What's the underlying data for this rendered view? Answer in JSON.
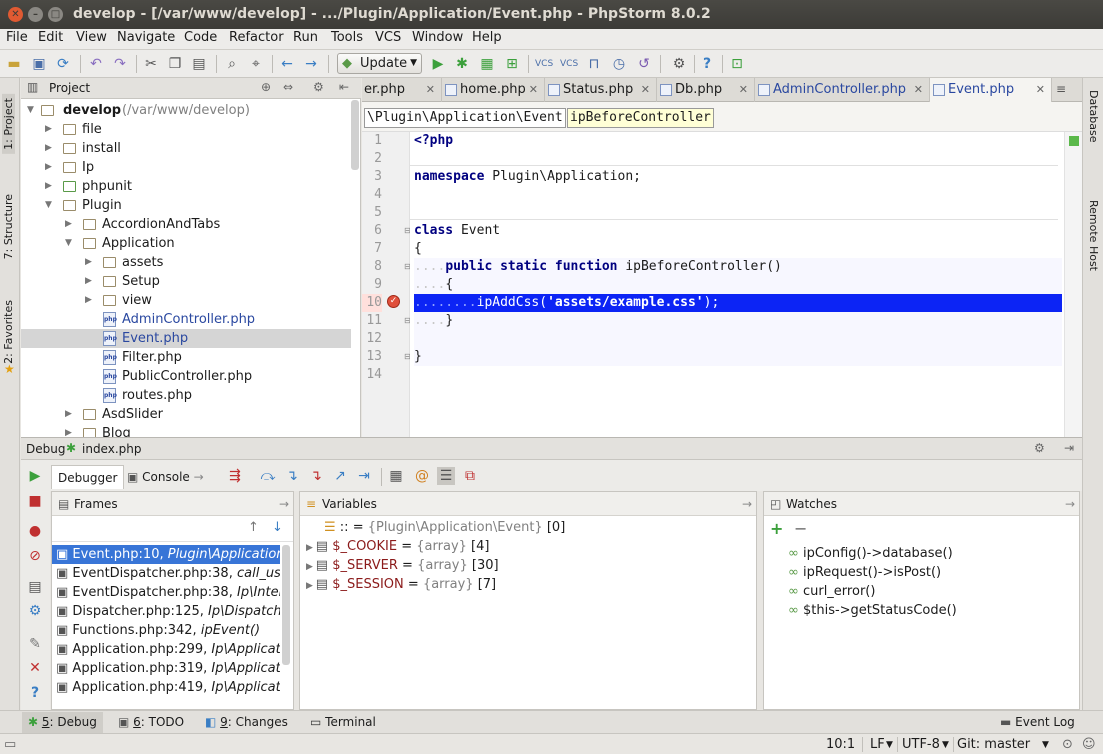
{
  "window": {
    "title": "develop - [/var/www/develop] - .../Plugin/Application/Event.php - PhpStorm 8.0.2"
  },
  "menu": [
    "File",
    "Edit",
    "View",
    "Navigate",
    "Code",
    "Refactor",
    "Run",
    "Tools",
    "VCS",
    "Window",
    "Help"
  ],
  "toolbar": {
    "update_label": "Update"
  },
  "left_tools": {
    "project": "1: Project",
    "structure": "7: Structure",
    "favorites": "2: Favorites"
  },
  "right_tools": {
    "database": "Database",
    "remote_host": "Remote Host"
  },
  "project": {
    "header": "Project",
    "root": {
      "name": "develop",
      "path": "(/var/www/develop)"
    },
    "items": [
      "file",
      "install",
      "Ip",
      "phpunit",
      "Plugin",
      "AccordionAndTabs",
      "Application",
      "assets",
      "Setup",
      "view",
      "AdminController.php",
      "Event.php",
      "Filter.php",
      "PublicController.php",
      "routes.php",
      "AsdSlider",
      "Blog"
    ]
  },
  "editor": {
    "tabs": [
      "er.php",
      "home.php",
      "Status.php",
      "Db.php",
      "AdminController.php",
      "Event.php"
    ],
    "breadcrumbs": [
      "\\Plugin\\Application\\Event",
      "ipBeforeController"
    ],
    "line_numbers": [
      "1",
      "2",
      "3",
      "4",
      "5",
      "6",
      "7",
      "8",
      "9",
      "10",
      "11",
      "12",
      "13",
      "14"
    ],
    "code": {
      "l1": "<?php",
      "l3_kw": "namespace",
      "l3_rest": " Plugin\\Application;",
      "l6_kw": "class",
      "l6_rest": " Event",
      "l7": "{",
      "l8_ws": "....",
      "l8_kw": "public static function",
      "l8_rest": " ipBeforeController()",
      "l9_ws": "....",
      "l9": "{",
      "l10_ws": "........",
      "l10_fn": "ipAddCss(",
      "l10_str": "'assets/example.css'",
      "l10_end": ");",
      "l11_ws": "....",
      "l11": "}",
      "l13": "}"
    }
  },
  "debug": {
    "title": "Debug",
    "config": "index.php",
    "tabs": {
      "debugger": "Debugger",
      "console": "Console"
    },
    "frames": {
      "header": "Frames",
      "rows": [
        {
          "loc": "Event.php:10,",
          "fn": "Plugin\\Application\\Event->ipBeforeController()"
        },
        {
          "loc": "EventDispatcher.php:38,",
          "fn": "call_user_func()"
        },
        {
          "loc": "EventDispatcher.php:38,",
          "fn": "Ip\\Internal\\EventDispatcher->event()"
        },
        {
          "loc": "Dispatcher.php:125,",
          "fn": "Ip\\Dispatcher->event()"
        },
        {
          "loc": "Functions.php:342,",
          "fn": "ipEvent()"
        },
        {
          "loc": "Application.php:299,",
          "fn": "Ip\\Application->handleRequest()"
        },
        {
          "loc": "Application.php:319,",
          "fn": "Ip\\Application->run()"
        },
        {
          "loc": "Application.php:419,",
          "fn": "Ip\\Application->run()"
        }
      ]
    },
    "variables": {
      "header": "Variables",
      "rows": [
        {
          "name": "::",
          "eq": " = ",
          "type": "{Plugin\\Application\\Event}",
          "val": " [0]"
        },
        {
          "name": "$_COOKIE",
          "eq": " = ",
          "type": "{array}",
          "val": " [4]"
        },
        {
          "name": "$_SERVER",
          "eq": " = ",
          "type": "{array}",
          "val": " [30]"
        },
        {
          "name": "$_SESSION",
          "eq": " = ",
          "type": "{array}",
          "val": " [7]"
        }
      ]
    },
    "watches": {
      "header": "Watches",
      "rows": [
        "ipConfig()->database()",
        "ipRequest()->isPost()",
        "curl_error()",
        "$this->getStatusCode()"
      ]
    }
  },
  "bottom_tabs": {
    "debug_num": "5",
    "debug": ": Debug",
    "todo_num": "6",
    "todo": ": TODO",
    "changes_num": "9",
    "changes": ": Changes",
    "terminal": "Terminal",
    "event_log": "Event Log"
  },
  "status": {
    "position": "10:1",
    "line_sep": "LF",
    "encoding": "UTF-8",
    "vcs": "Git: master"
  }
}
